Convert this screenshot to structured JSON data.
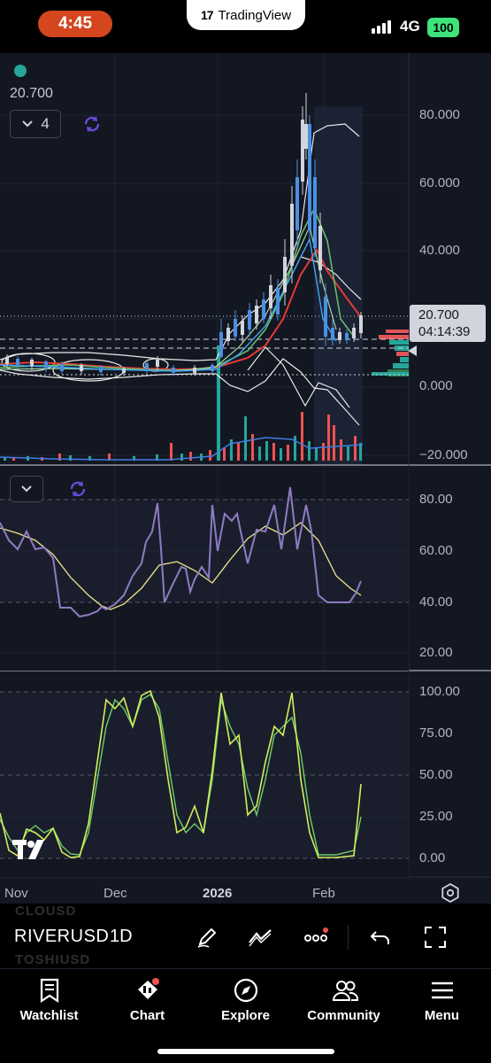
{
  "status_bar": {
    "time": "4:45",
    "app_badge": "TradingView",
    "network": "4G",
    "battery": "100"
  },
  "chart": {
    "legend_value": "20.700",
    "collapsed_indicator_count": "4",
    "last_price": "20.700",
    "countdown": "04:14:39",
    "price_axis": [
      "80.000",
      "60.000",
      "40.000",
      "20.000",
      "0.000",
      "−20.000"
    ],
    "rsi_axis": [
      "80.00",
      "60.00",
      "40.00",
      "20.00"
    ],
    "stoch_axis": [
      "100.00",
      "75.00",
      "50.00",
      "25.00",
      "0.00"
    ],
    "time_axis": [
      "Nov",
      "Dec",
      "2026",
      "Feb"
    ],
    "colors": {
      "background": "#131722",
      "up_candle": "#4a90e2",
      "down_candle": "#d1d4dc",
      "rsi_line": "#8e7cc3",
      "rsi_signal": "#f0e68c",
      "stoch_k": "#d4ee5a",
      "stoch_d": "#6fcf6f"
    }
  },
  "chart_data": [
    {
      "type": "line",
      "title": "",
      "x": [
        "Nov",
        "Dec",
        "2026",
        "Feb"
      ],
      "ylim": [
        -20,
        85
      ],
      "series": [
        {
          "values": [
            6.5,
            7.2,
            7.8,
            7.0,
            6.4,
            6.8,
            7.3,
            6.2,
            5.4,
            5.2,
            5.0,
            4.6,
            4.8,
            5.3,
            5.2,
            5.4,
            5.6,
            7.6,
            8.4,
            6.0,
            5.6,
            5.2,
            5.1,
            5.6,
            5.5,
            7.8,
            16.8,
            19.2,
            18.0,
            22.0,
            21.0,
            27.0,
            33.0,
            31.0,
            42.0,
            54.0,
            72.0,
            78.0,
            56.0,
            38.0,
            22.0,
            18.0,
            17.5,
            20.7
          ]
        }
      ],
      "annotations": [
        "20.700",
        "04:14:39"
      ]
    },
    {
      "type": "line",
      "ylim": [
        15,
        88
      ],
      "series": [
        {
          "values": [
            75,
            72,
            70,
            71,
            69,
            66,
            62,
            55,
            47,
            40,
            37,
            36,
            37,
            40,
            46,
            52,
            58,
            66,
            82,
            62,
            51,
            47,
            53,
            58,
            47,
            52,
            68,
            82,
            74,
            77,
            70,
            62,
            72,
            80,
            76,
            86,
            71,
            75,
            55,
            43,
            41,
            41,
            41,
            48
          ]
        },
        {
          "values": [
            72,
            71,
            70,
            68,
            66,
            63,
            60,
            56,
            51,
            47,
            43,
            40,
            38,
            38,
            39,
            42,
            45,
            49,
            55,
            57,
            56,
            55,
            54,
            55,
            53,
            52,
            57,
            62,
            67,
            70,
            71,
            71,
            72,
            72,
            72,
            73,
            72,
            70,
            65,
            58,
            51,
            46,
            43,
            42
          ]
        }
      ]
    },
    {
      "type": "line",
      "ylim": [
        0,
        100
      ],
      "series": [
        {
          "values": [
            40,
            10,
            2,
            25,
            20,
            15,
            5,
            0,
            0,
            40,
            85,
            75,
            98,
            80,
            100,
            70,
            40,
            15,
            20,
            5,
            20,
            48,
            90,
            100,
            68,
            72,
            50,
            40,
            62,
            80,
            72,
            95,
            98,
            60,
            0,
            2,
            3,
            3,
            3,
            5,
            40
          ]
        },
        {
          "values": [
            45,
            20,
            5,
            20,
            22,
            18,
            8,
            2,
            2,
            30,
            75,
            80,
            90,
            85,
            95,
            80,
            50,
            22,
            18,
            8,
            18,
            40,
            80,
            98,
            75,
            70,
            55,
            42,
            58,
            75,
            75,
            90,
            95,
            70,
            5,
            2,
            3,
            3,
            3,
            4,
            25
          ]
        }
      ]
    }
  ],
  "toolbar": {
    "ghost_top": "CLOUSD",
    "symbol": "RIVERUSD",
    "ghost_bottom": "TOSHIUSD",
    "interval": "1D"
  },
  "tabs": [
    {
      "label": "Watchlist",
      "icon": "watchlist-icon"
    },
    {
      "label": "Chart",
      "icon": "chart-icon"
    },
    {
      "label": "Explore",
      "icon": "compass-icon"
    },
    {
      "label": "Community",
      "icon": "community-icon"
    },
    {
      "label": "Menu",
      "icon": "menu-icon"
    }
  ]
}
